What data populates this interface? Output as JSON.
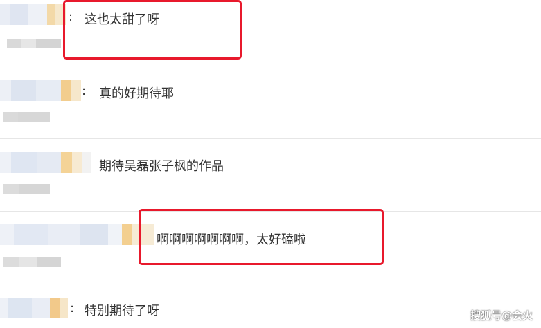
{
  "comments": [
    {
      "text": "这也太甜了呀",
      "colon": ":"
    },
    {
      "text": "真的好期待耶",
      "colon": ":"
    },
    {
      "text": "期待吴磊张子枫的作品",
      "colon": ""
    },
    {
      "text": "啊啊啊啊啊啊啊，太好磕啦",
      "colon": ""
    },
    {
      "text": "特别期待了呀",
      "colon": ":"
    }
  ],
  "watermark": "搜狐号@会火",
  "colors": {
    "highlight": "#e8192c",
    "divider": "#e6e6e6"
  }
}
